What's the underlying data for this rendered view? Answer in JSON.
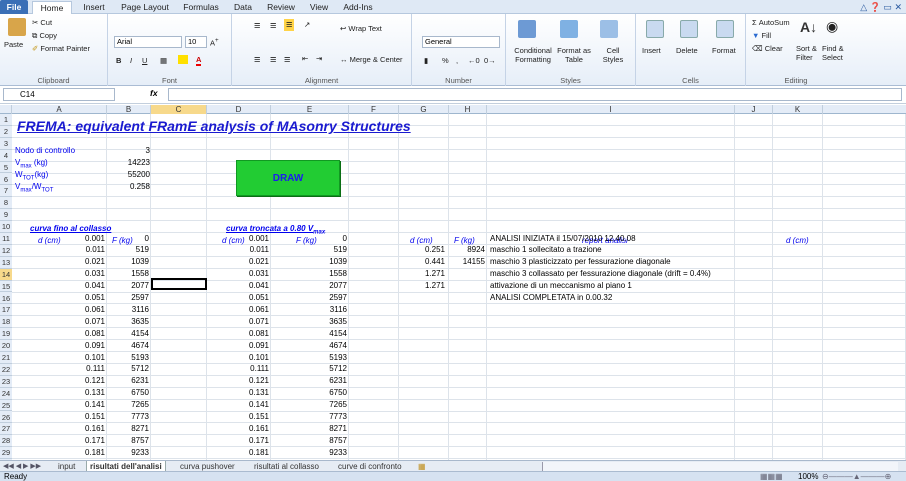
{
  "ribbon_tabs": [
    "File",
    "Home",
    "Insert",
    "Page Layout",
    "Formulas",
    "Data",
    "Review",
    "View",
    "Add-Ins"
  ],
  "clipboard": {
    "paste": "Paste",
    "cut": "Cut",
    "copy": "Copy",
    "format_painter": "Format Painter",
    "label": "Clipboard"
  },
  "font": {
    "name": "Arial",
    "size": "10",
    "label": "Font",
    "bold": "B",
    "italic": "I",
    "underline": "U"
  },
  "alignment": {
    "wrap": "Wrap Text",
    "merge": "Merge & Center",
    "label": "Alignment"
  },
  "number": {
    "format": "General",
    "label": "Number",
    "percent": "%"
  },
  "styles": {
    "cond": "Conditional Formatting",
    "table": "Format as Table",
    "cell": "Cell Styles",
    "label": "Styles"
  },
  "cells": {
    "insert": "Insert",
    "delete": "Delete",
    "format": "Format",
    "label": "Cells"
  },
  "editing": {
    "autosum": "AutoSum",
    "fill": "Fill",
    "clear": "Clear",
    "sort": "Sort & Filter",
    "find": "Find & Select",
    "label": "Editing"
  },
  "formula_bar": {
    "name_box": "C14",
    "fx": "fx",
    "content": ""
  },
  "columns": [
    "A",
    "B",
    "C",
    "D",
    "E",
    "F",
    "G",
    "H",
    "I",
    "J",
    "K"
  ],
  "sheet": {
    "title": "FREMA: equivalent FRamE analysis of MAsonry Structures",
    "control_node_label": "Nodo di controllo",
    "control_node_value": "3",
    "vmax_label": "V max (kg)",
    "vmax_value": "14223",
    "wtot_label": "W TOT(kg)",
    "wtot_value": "55200",
    "ratio_label": "V max/W TOT",
    "ratio_value": "0.258",
    "draw_button": "DRAW",
    "curve1_title": "curva fino al collasso",
    "curve2_title": "curva troncata a 0.80 V max",
    "col_d": "d (cm)",
    "col_f": "F (kg)",
    "report_header": "report analisi",
    "curve_d": [
      "0.001",
      "0.011",
      "0.021",
      "0.031",
      "0.041",
      "0.051",
      "0.061",
      "0.071",
      "0.081",
      "0.091",
      "0.101",
      "0.111",
      "0.121",
      "0.131",
      "0.141",
      "0.151",
      "0.161",
      "0.171",
      "0.181"
    ],
    "curve_f": [
      "0",
      "519",
      "1039",
      "1558",
      "2077",
      "2597",
      "3116",
      "3635",
      "4154",
      "4674",
      "5193",
      "5712",
      "6231",
      "6750",
      "7265",
      "7773",
      "8271",
      "8757",
      "9233"
    ],
    "events_d": [
      "0.251",
      "0.441",
      "1.271",
      "1.271"
    ],
    "events_f": [
      "8924",
      "14155"
    ],
    "report": [
      "ANALISI INIZIATA il 15/07/2010 12.40.08",
      "maschio 1 sollecitato a trazione",
      "maschio 3 plasticizzato per fessurazione diagonale",
      "maschio 3 collassato per fessurazione diagonale (drift = 0.4%)",
      "attivazione di un meccanismo al piano 1",
      "ANALISI COMPLETATA in 0.00.32"
    ]
  },
  "sheet_tabs": [
    "input",
    "risultati dell'analisi",
    "curva pushover",
    "risultati al collasso",
    "curve di confronto"
  ],
  "status": {
    "ready": "Ready",
    "zoom": "100%"
  }
}
